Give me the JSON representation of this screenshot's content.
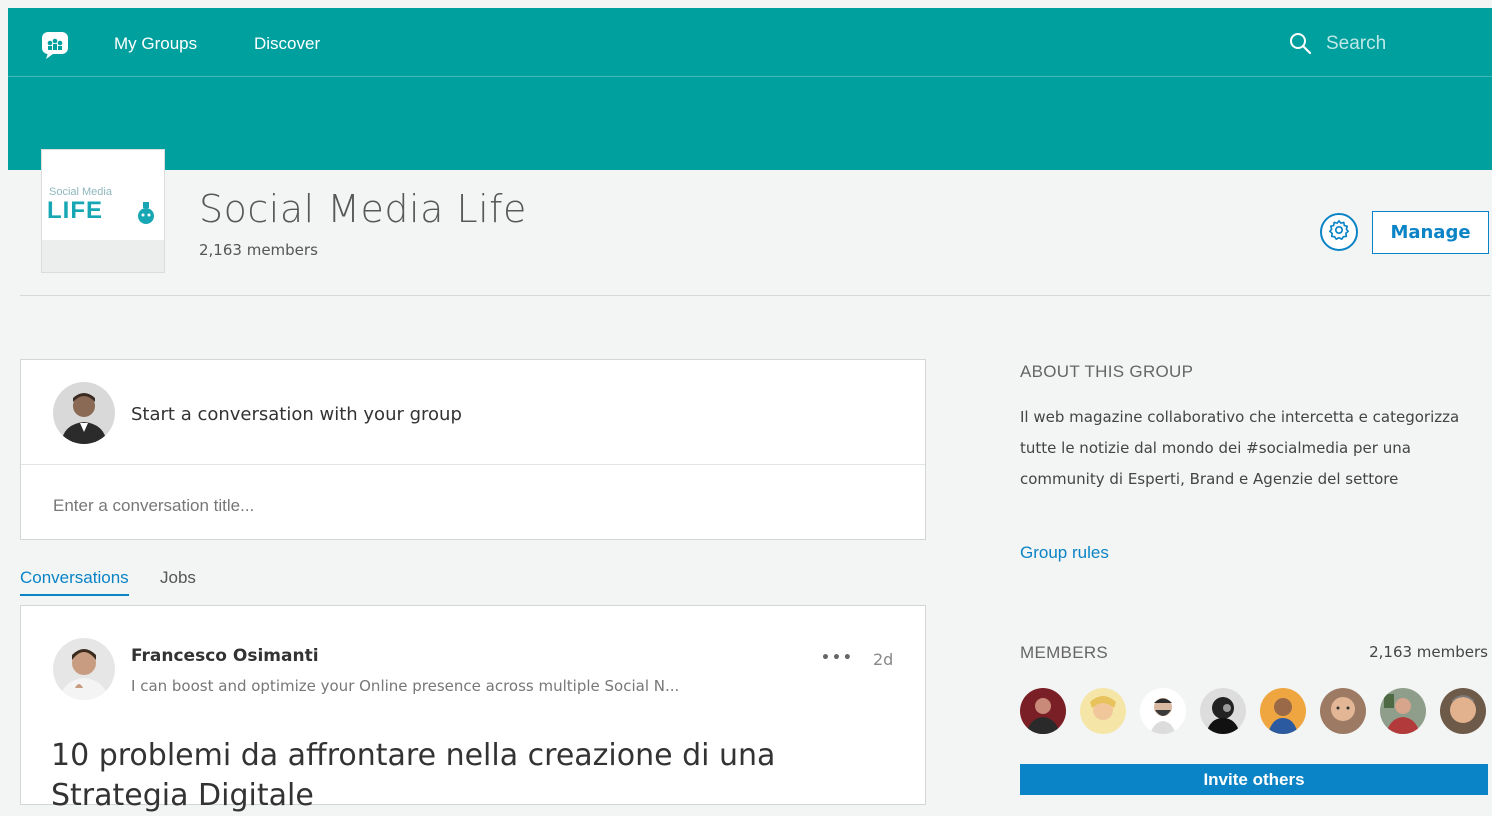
{
  "nav": {
    "logo_icon": "groups-chat-icon",
    "links": [
      "My Groups",
      "Discover"
    ],
    "search_icon": "search-icon",
    "search_placeholder": "Search"
  },
  "group": {
    "logo_text_top": "Social Media",
    "logo_text_main": "LIFE",
    "name": "Social Media Life",
    "members_label": "2,163 members",
    "settings_icon": "gear-icon",
    "manage_label": "Manage"
  },
  "compose": {
    "prompt": "Start a conversation with your group",
    "title_placeholder": "Enter a conversation title..."
  },
  "tabs": [
    "Conversations",
    "Jobs"
  ],
  "post": {
    "author": "Francesco Osimanti",
    "headline": "I can boost and optimize your Online presence across multiple Social N...",
    "more_icon": "more-dots-icon",
    "time": "2d",
    "title": "10 problemi da affrontare nella creazione di una Strategia Digitale"
  },
  "about": {
    "heading": "ABOUT THIS GROUP",
    "description": "Il web magazine collaborativo che intercetta e categorizza tutte le notizie dal mondo dei #socialmedia per una community di Esperti, Brand e Agenzie del settore",
    "rules_link": "Group rules"
  },
  "members": {
    "heading": "MEMBERS",
    "count_label": "2,163 members",
    "invite_label": "Invite others"
  },
  "colors": {
    "header": "#00a09e",
    "accent": "#0a84c6",
    "background": "#f3f4f4"
  }
}
